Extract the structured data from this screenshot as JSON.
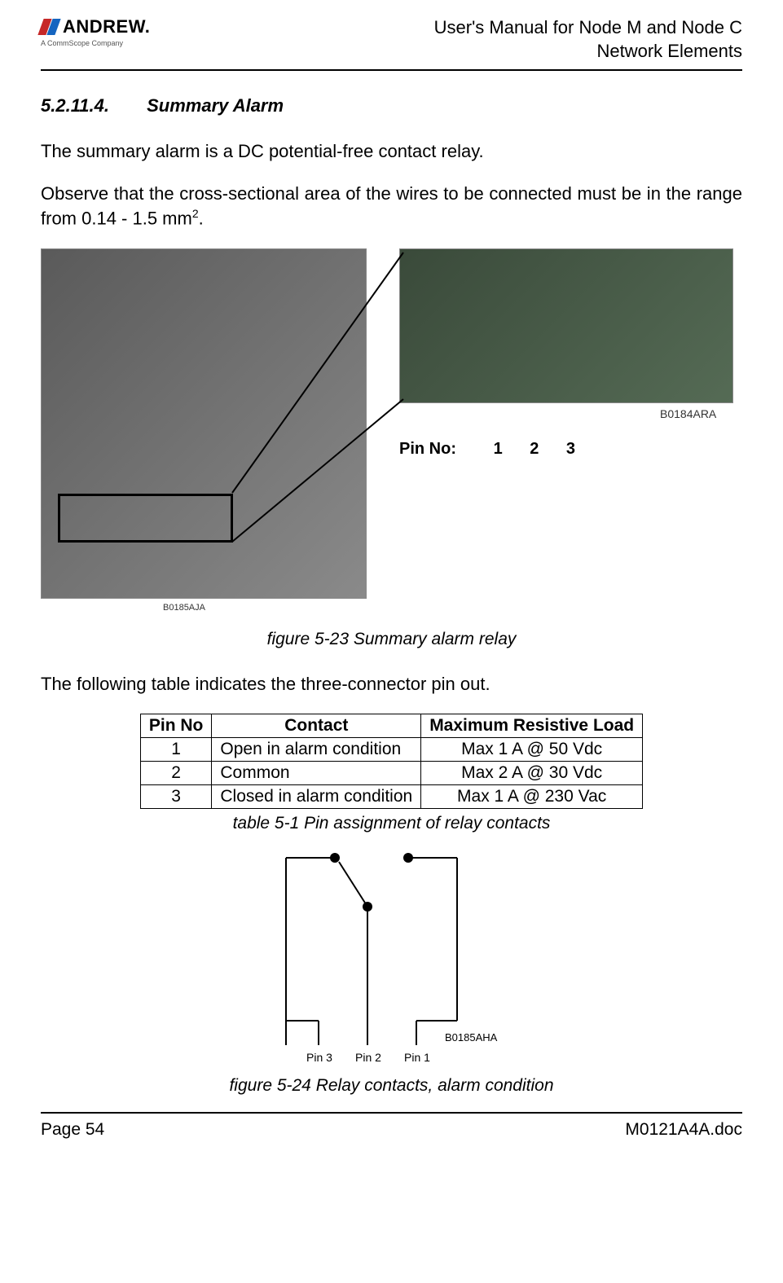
{
  "header": {
    "brand": "ANDREW.",
    "subtitle": "A CommScope Company",
    "doc_title_line1": "User's Manual for Node M and Node C",
    "doc_title_line2": "Network Elements"
  },
  "section": {
    "number": "5.2.11.4.",
    "title": "Summary Alarm"
  },
  "paragraphs": {
    "p1": "The summary alarm is a DC potential-free contact relay.",
    "p2_prefix": "Observe that the cross-sectional area of the wires to be connected must be in the range from 0.14 - 1.5 mm",
    "p2_super": "2",
    "p2_suffix": ".",
    "p3": "The following table indicates the three-connector pin out."
  },
  "figure1": {
    "photo_left_id": "B0185AJA",
    "photo_right_id": "B0184ARA",
    "pin_label": "Pin No:",
    "pin_numbers": "1  2  3",
    "caption": "figure 5-23 Summary alarm relay"
  },
  "table": {
    "headers": {
      "c1": "Pin No",
      "c2": "Contact",
      "c3": "Maximum Resistive Load"
    },
    "rows": [
      {
        "c1": "1",
        "c2": "Open in alarm condition",
        "c3": "Max 1 A @ 50 Vdc"
      },
      {
        "c1": "2",
        "c2": "Common",
        "c3": "Max 2 A @ 30 Vdc"
      },
      {
        "c1": "3",
        "c2": "Closed in alarm condition",
        "c3": "Max 1 A @ 230 Vac"
      }
    ],
    "caption": "table 5-1 Pin assignment of relay contacts"
  },
  "figure2": {
    "pin3": "Pin 3",
    "pin2": "Pin 2",
    "pin1": "Pin 1",
    "diagram_id": "B0185AHA",
    "caption": "figure 5-24 Relay contacts, alarm condition"
  },
  "footer": {
    "page": "Page 54",
    "docref": "M0121A4A.doc"
  }
}
